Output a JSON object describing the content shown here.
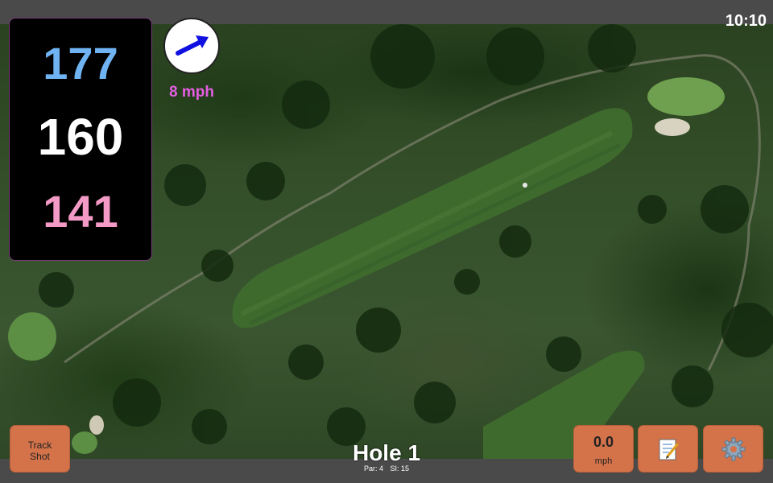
{
  "status": {
    "time": "10:10"
  },
  "yardages": {
    "back": "177",
    "center": "160",
    "front": "141"
  },
  "wind": {
    "speed": "8 mph",
    "icon": "wind-direction-arrow-icon"
  },
  "hole": {
    "title": "Hole 1",
    "par": "Par: 4",
    "stroke_index": "SI: 15"
  },
  "buttons": {
    "track_shot_line1": "Track",
    "track_shot_line2": "Shot",
    "speed_value": "0.0",
    "speed_unit": "mph",
    "notes_icon": "notepad-icon",
    "settings_icon": "gear-icon"
  },
  "colors": {
    "back": "#6fb3f2",
    "center": "#ffffff",
    "front": "#f49ac6",
    "wind_text": "#e35ee0",
    "button": "#d4734a"
  }
}
